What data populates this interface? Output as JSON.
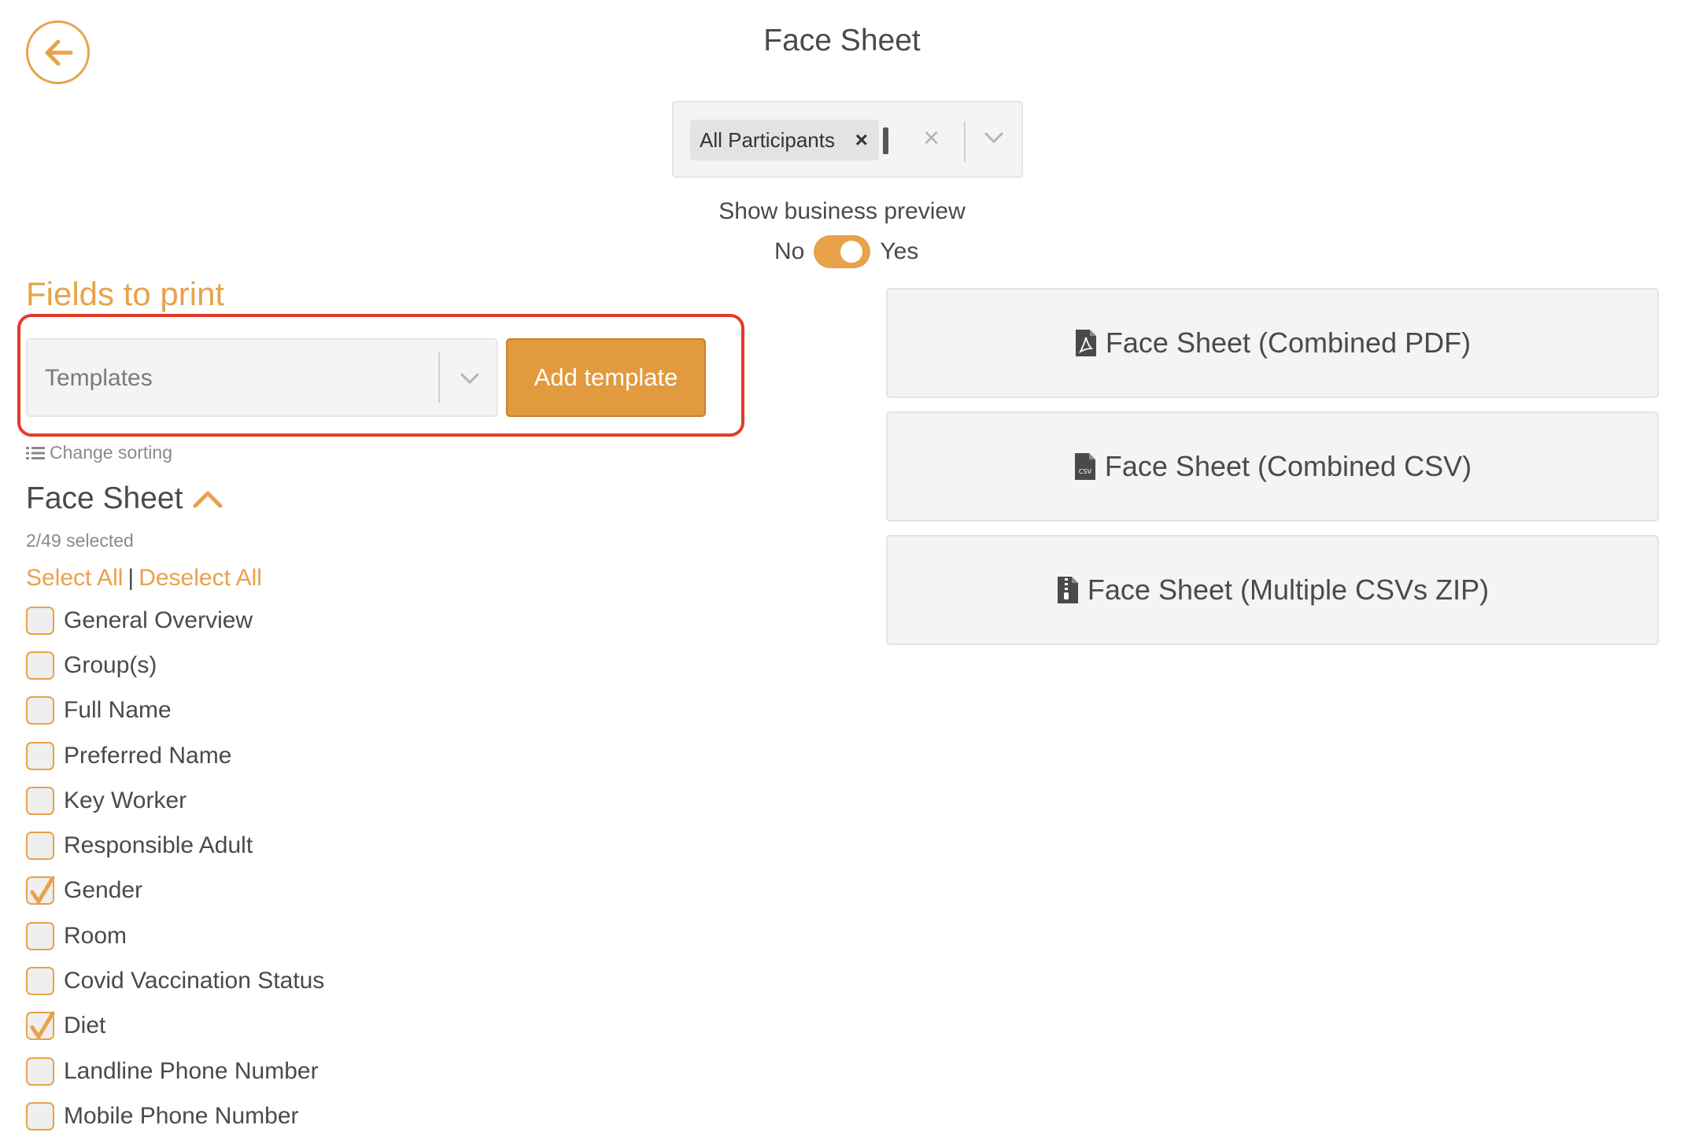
{
  "header": {
    "title": "Face Sheet"
  },
  "participants": {
    "chip_label": "All Participants",
    "chip_remove": "×",
    "clear": "×"
  },
  "preview": {
    "label": "Show business preview",
    "no": "No",
    "yes": "Yes",
    "value": true
  },
  "fields": {
    "heading": "Fields to print",
    "templates_placeholder": "Templates",
    "add_template_label": "Add template",
    "change_sorting": "Change sorting",
    "section_title": "Face Sheet",
    "selected_count": "2/49 selected",
    "select_all": "Select All",
    "separator": "|",
    "deselect_all": "Deselect All",
    "items": [
      {
        "label": "General Overview",
        "checked": false
      },
      {
        "label": "Group(s)",
        "checked": false
      },
      {
        "label": "Full Name",
        "checked": false
      },
      {
        "label": "Preferred Name",
        "checked": false
      },
      {
        "label": "Key Worker",
        "checked": false
      },
      {
        "label": "Responsible Adult",
        "checked": false
      },
      {
        "label": "Gender",
        "checked": true
      },
      {
        "label": "Room",
        "checked": false
      },
      {
        "label": "Covid Vaccination Status",
        "checked": false
      },
      {
        "label": "Diet",
        "checked": true
      },
      {
        "label": "Landline Phone Number",
        "checked": false
      },
      {
        "label": "Mobile Phone Number",
        "checked": false
      }
    ]
  },
  "exports": [
    {
      "label": "Face Sheet (Combined PDF)",
      "icon": "pdf-file-icon"
    },
    {
      "label": "Face Sheet (Combined CSV)",
      "icon": "csv-file-icon"
    },
    {
      "label": "Face Sheet (Multiple CSVs ZIP)",
      "icon": "zip-file-icon"
    }
  ],
  "colors": {
    "accent": "#e8a24a",
    "button": "#e29a3e",
    "highlight": "#e23b2a"
  }
}
